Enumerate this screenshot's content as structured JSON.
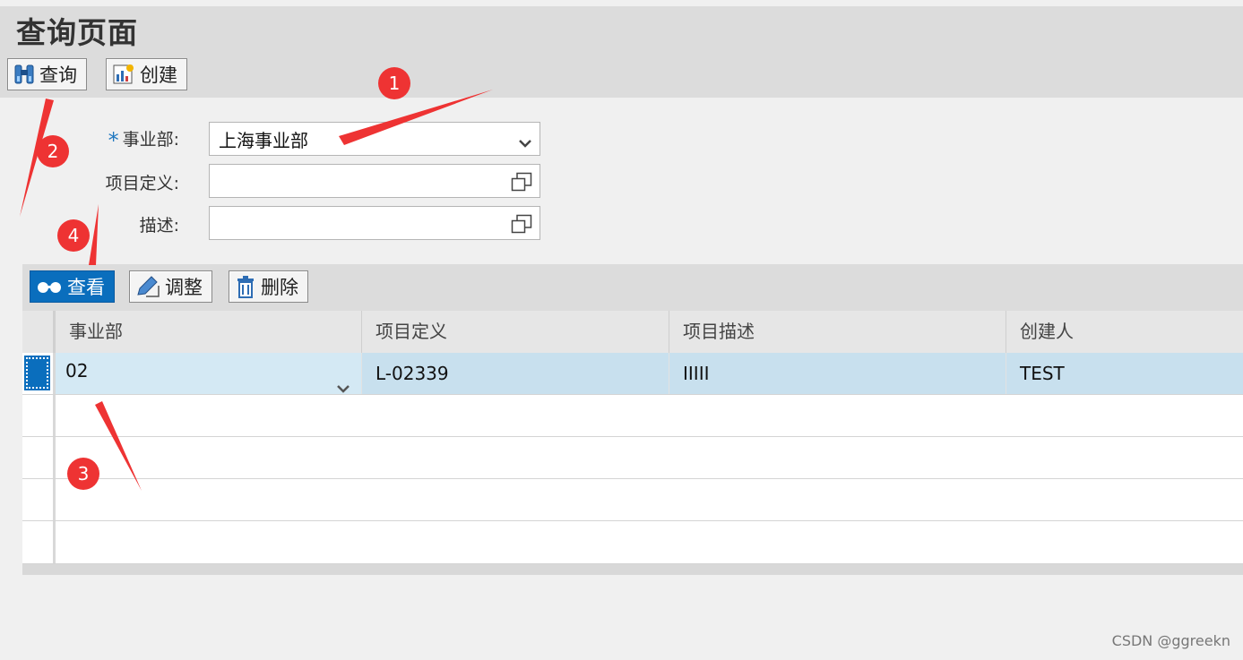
{
  "page": {
    "title": "查询页面"
  },
  "toolbar": {
    "query_label": "查询",
    "create_label": "创建"
  },
  "form": {
    "division": {
      "label": "事业部:",
      "required_marker": "*",
      "value": "上海事业部"
    },
    "project_def": {
      "label": "项目定义:",
      "value": ""
    },
    "description": {
      "label": "描述:",
      "value": ""
    }
  },
  "table_toolbar": {
    "view_label": "查看",
    "adjust_label": "调整",
    "delete_label": "删除"
  },
  "table": {
    "columns": [
      "事业部",
      "项目定义",
      "项目描述",
      "创建人"
    ],
    "rows": [
      {
        "division": "02",
        "project_def": "L-02339",
        "description": "IIIII",
        "creator": "TEST"
      }
    ]
  },
  "annotations": {
    "a1": "1",
    "a2": "2",
    "a3": "3",
    "a4": "4"
  },
  "watermark": "CSDN @ggreekn",
  "colors": {
    "accent": "#0a6ebd",
    "selected_row": "#c8e0ee",
    "marker": "#ee3333"
  }
}
